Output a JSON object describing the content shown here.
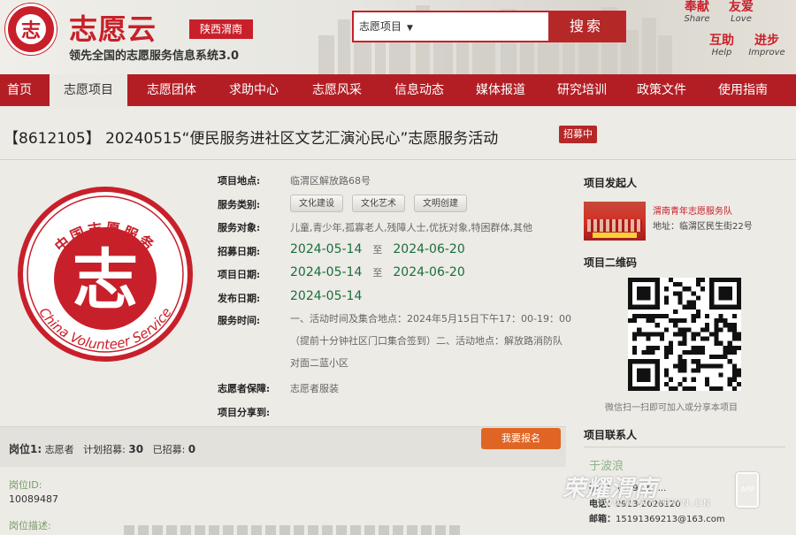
{
  "header": {
    "logo_icon": "volunteer-logo-icon",
    "logo_char": "志",
    "brand": "志愿云",
    "region": "陕西渭南",
    "slogan": "领先全国的志愿服务信息系统3.0",
    "search": {
      "select_value": "志愿项目",
      "button": "搜索"
    },
    "mottos": [
      {
        "cn": "奉献",
        "en": "Share"
      },
      {
        "cn": "友爱",
        "en": "Love"
      },
      {
        "cn": "互助",
        "en": "Help"
      },
      {
        "cn": "进步",
        "en": "Improve"
      }
    ]
  },
  "nav": {
    "active_index": 1,
    "items": [
      "首页",
      "志愿项目",
      "志愿团体",
      "求助中心",
      "志愿风采",
      "信息动态",
      "媒体报道",
      "研究培训",
      "政策文件",
      "使用指南"
    ]
  },
  "project": {
    "title": "【8612105】 20240515“便民服务进社区文艺汇演沁民心”志愿服务活动",
    "status_badge": "招募中",
    "emblem": {
      "top_text": "中国志愿服务",
      "center_char": "志",
      "bottom_text": "China Volunteer Service"
    },
    "info": {
      "location_label": "项目地点:",
      "location": "临渭区解放路68号",
      "category_label": "服务类别:",
      "categories": [
        "文化建设",
        "文化艺术",
        "文明创建"
      ],
      "target_label": "服务对象:",
      "target": "儿童,青少年,孤寡老人,残障人士,优抚对象,特困群体,其他",
      "recruit_label": "招募日期:",
      "recruit_start": "2024-05-14",
      "recruit_end": "2024-06-20",
      "project_date_label": "项目日期:",
      "project_start": "2024-05-14",
      "project_end": "2024-06-20",
      "publish_label": "发布日期:",
      "publish_date": "2024-05-14",
      "to": "至",
      "time_label": "服务时间:",
      "time": "一、活动时间及集合地点：2024年5月15日下午17：00-19：00（提前十分钟社区门口集合签到）二、活动地点：解放路消防队对面二蓝小区",
      "insurance_label": "志愿者保障:",
      "insurance": "志愿者服装",
      "share_label": "项目分享到:"
    },
    "position": {
      "label": "岗位1:",
      "role": "志愿者",
      "plan_label": "计划招募:",
      "plan": "30",
      "recruited_label": "已招募:",
      "recruited": "0",
      "signup_button": "我要报名",
      "id_label": "岗位ID:",
      "id": "10089487",
      "desc_label": "岗位描述:"
    }
  },
  "sidebar": {
    "sponsor_heading": "项目发起人",
    "sponsor_name": "渭南青年志愿服务队",
    "sponsor_address": "地址：临渭区民生街22号",
    "qr_heading": "项目二维码",
    "qr_caption": "微信扫一扫即可加入或分享本项目",
    "contact_heading": "项目联系人",
    "contact_name": "于波浪",
    "phone_label": "手机：",
    "phone": "1519...67...",
    "tel_label": "电话：",
    "tel": "0913-2026120",
    "email_label": "邮箱：",
    "email": "15191369213@163.com"
  },
  "watermark": {
    "cn": "荣耀渭南",
    "en": "WWW.WNYEWN.CN",
    "app": "APP"
  },
  "colors": {
    "brand_red": "#c8202a",
    "nav_red": "#b31e25",
    "date_green": "#1b6e3a",
    "signup_orange": "#e06524"
  }
}
